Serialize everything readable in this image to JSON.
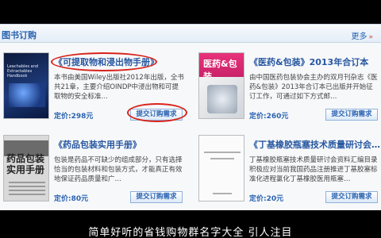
{
  "header": {
    "title": "图书订购",
    "more": "更多",
    "more_arrow": "»"
  },
  "books": [
    {
      "title": "《可提取物和浸出物手册》",
      "desc": "本书由美国Wiley出版社2012年出版，全书共21章，主要介绍OINDP中浸出物和可提取物的安全标准…",
      "price": "定价:298元",
      "button": "提交订购需求",
      "cover_text": "Leachables and Extractables Handbook"
    },
    {
      "title": "《医药&包装》2013年合订本",
      "desc": "由中国医药包装协会主办的双月刊杂志《医药&包装》2013年合订本已出版并开始征订工作，可通过如下方式邮…",
      "price": "定价:260元",
      "button": "提交订购需求",
      "cover_text": "医药&包装"
    },
    {
      "title": "《药品包装实用手册》",
      "desc": "包装是药品不可缺少的组成部分，只有选择恰当的包装材料和包装方式，才能真正有效地保证药品质量和广…",
      "price": "定价:80元",
      "button": "提交订购需求",
      "cover_text": "药品包装实用手册"
    },
    {
      "title": "《丁基橡胶瓶塞技术质量研讨会…",
      "desc": "丁基橡胶瓶塞技术质量研讨会资料汇编目录积极应对当前我国药品注册推进丁基胶塞标准化进程氯化丁基橡胶医用瓶塞…",
      "price": "定价:20元",
      "button": "提交订购需求",
      "cover_text": ""
    }
  ],
  "subtitle": "简单好听的省钱购物群名字大全 引人注目",
  "colors": {
    "link_blue": "#2a63b1",
    "highlight_red": "#d8231a"
  }
}
